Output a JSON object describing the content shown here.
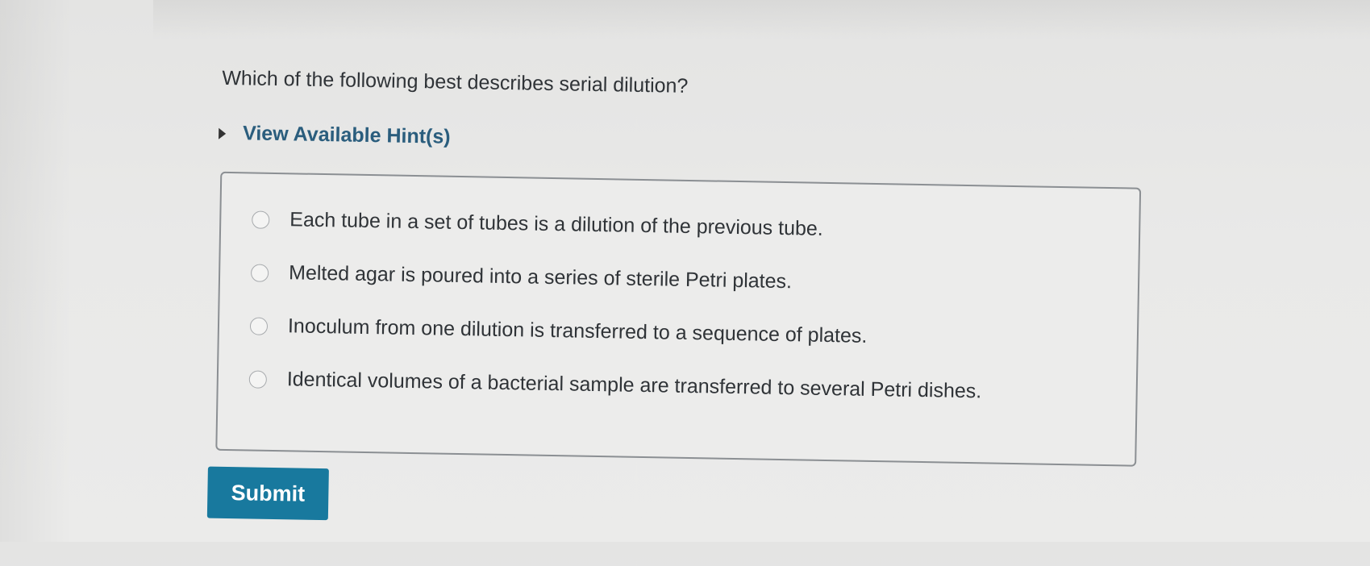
{
  "question": {
    "text": "Which of the following best describes serial dilution?"
  },
  "hints": {
    "label": "View Available Hint(s)"
  },
  "choices": [
    {
      "text": "Each tube in a set of tubes is a dilution of the previous tube.",
      "selected": false
    },
    {
      "text": "Melted agar is poured into a series of sterile Petri plates.",
      "selected": false
    },
    {
      "text": "Inoculum from one dilution is transferred to a sequence of plates.",
      "selected": false
    },
    {
      "text": "Identical volumes of a bacterial sample are transferred to several Petri dishes.",
      "selected": false
    }
  ],
  "submit": {
    "label": "Submit"
  },
  "colors": {
    "hint_text": "#2a5d7d",
    "submit_bg": "#18799e",
    "background": "#e9e9e8"
  }
}
